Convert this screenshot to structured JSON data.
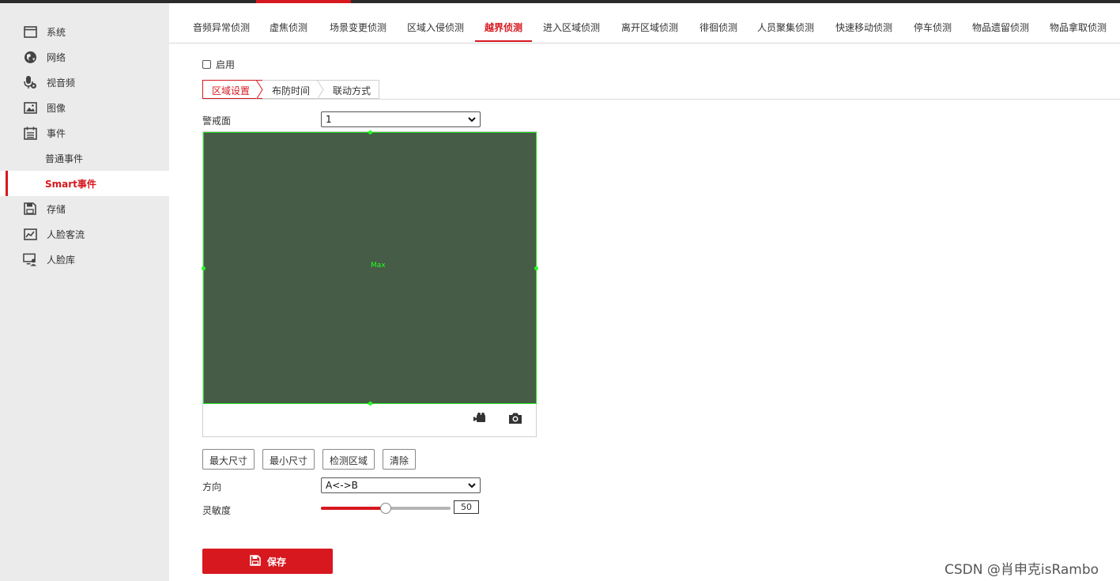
{
  "sidebar": {
    "items": [
      {
        "label": "系统",
        "icon": "window-icon"
      },
      {
        "label": "网络",
        "icon": "globe-icon"
      },
      {
        "label": "视音频",
        "icon": "mic-icon"
      },
      {
        "label": "图像",
        "icon": "image-icon"
      },
      {
        "label": "事件",
        "icon": "calendar-icon"
      }
    ],
    "sub_items": [
      "普通事件",
      "Smart事件"
    ],
    "items_after": [
      {
        "label": "存储",
        "icon": "disk-icon"
      },
      {
        "label": "人脸客流",
        "icon": "chart-icon"
      },
      {
        "label": "人脸库",
        "icon": "monitor-user-icon"
      }
    ],
    "active_sub": "Smart事件"
  },
  "tabs": [
    "音频异常侦测",
    "虚焦侦测",
    "场景变更侦测",
    "区域入侵侦测",
    "越界侦测",
    "进入区域侦测",
    "离开区域侦测",
    "徘徊侦测",
    "人员聚集侦测",
    "快速移动侦测",
    "停车侦测",
    "物品遗留侦测",
    "物品拿取侦测"
  ],
  "active_tab": "越界侦测",
  "enable": {
    "label": "启用",
    "checked": false
  },
  "subtabs": [
    "区域设置",
    "布防时间",
    "联动方式"
  ],
  "form": {
    "zone_label": "警戒面",
    "zone_value": "1",
    "canvas_text": "Max",
    "buttons": [
      "最大尺寸",
      "最小尺寸",
      "检测区域",
      "清除"
    ],
    "direction_label": "方向",
    "direction_value": "A<->B",
    "sensitivity_label": "灵敏度",
    "sensitivity_value": "50",
    "sensitivity_fraction": 0.5
  },
  "save_label": "保存",
  "watermark": "CSDN @肖申克isRambo",
  "colors": {
    "accent": "#d7181f",
    "canvas": "#465c46",
    "line": "#20ff20"
  }
}
